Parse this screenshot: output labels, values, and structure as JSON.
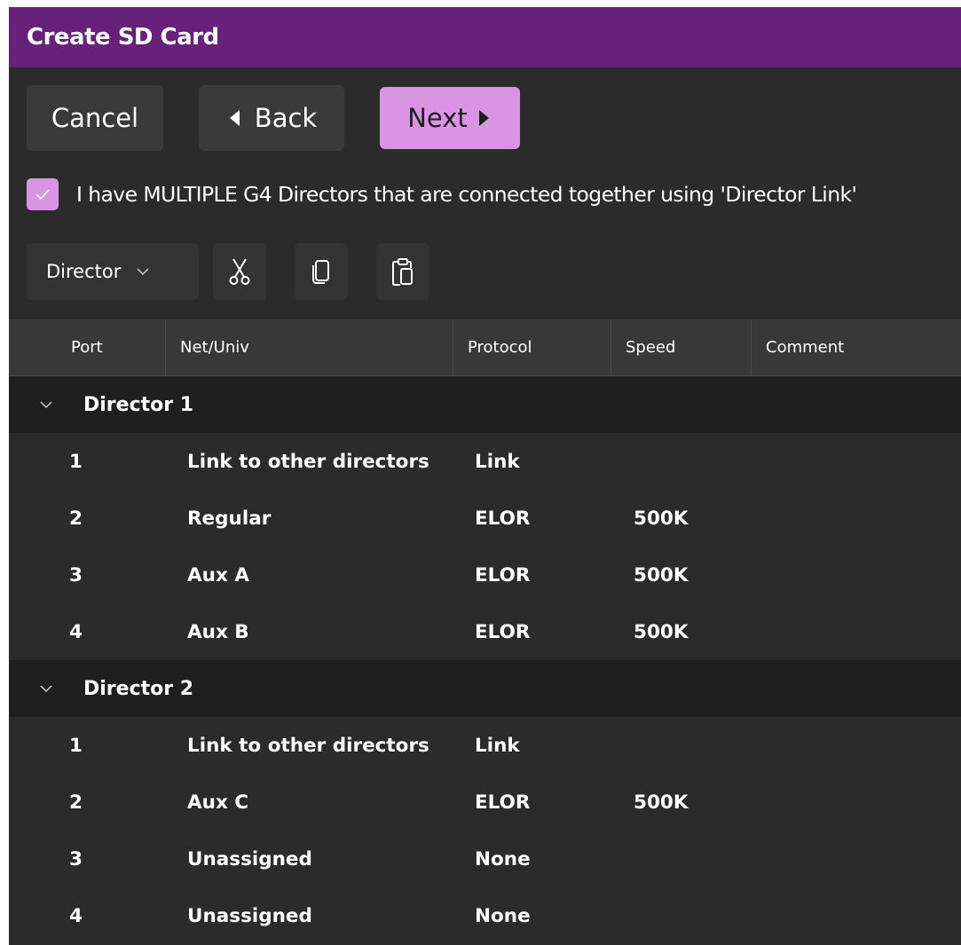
{
  "window": {
    "title": "Create SD Card"
  },
  "toolbar": {
    "cancel_label": "Cancel",
    "back_label": "Back",
    "next_label": "Next"
  },
  "multi_director": {
    "checked": true,
    "label": "I have MULTIPLE G4 Directors that are connected together using 'Director Link'"
  },
  "tools": {
    "dropdown_value": "Director",
    "icons": [
      "cut-icon",
      "copy-icon",
      "paste-icon"
    ]
  },
  "table": {
    "columns": [
      "Port",
      "Net/Univ",
      "Protocol",
      "Speed",
      "Comment"
    ],
    "groups": [
      {
        "name": "Director 1",
        "rows": [
          {
            "port": "1",
            "net": "Link to other directors",
            "protocol": "Link",
            "speed": "",
            "comment": ""
          },
          {
            "port": "2",
            "net": "Regular",
            "protocol": "ELOR",
            "speed": "500K",
            "comment": ""
          },
          {
            "port": "3",
            "net": "Aux A",
            "protocol": "ELOR",
            "speed": "500K",
            "comment": ""
          },
          {
            "port": "4",
            "net": "Aux B",
            "protocol": "ELOR",
            "speed": "500K",
            "comment": ""
          }
        ]
      },
      {
        "name": "Director 2",
        "rows": [
          {
            "port": "1",
            "net": "Link to other directors",
            "protocol": "Link",
            "speed": "",
            "comment": ""
          },
          {
            "port": "2",
            "net": "Aux C",
            "protocol": "ELOR",
            "speed": "500K",
            "comment": ""
          },
          {
            "port": "3",
            "net": "Unassigned",
            "protocol": "None",
            "speed": "",
            "comment": ""
          },
          {
            "port": "4",
            "net": "Unassigned",
            "protocol": "None",
            "speed": "",
            "comment": ""
          }
        ]
      }
    ]
  },
  "colors": {
    "titlebar": "#68217a",
    "accent": "#da94e4",
    "background": "#2b2b2b",
    "group_header": "#1f1f1f"
  }
}
